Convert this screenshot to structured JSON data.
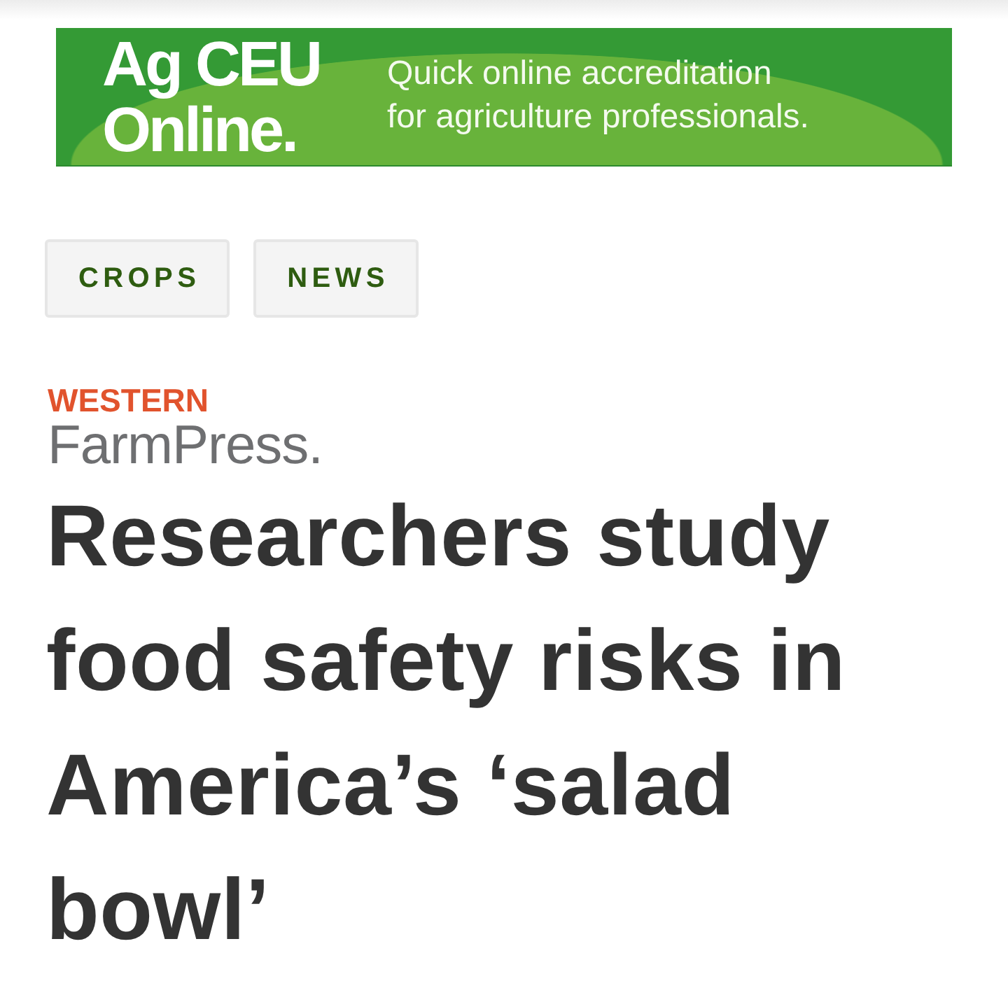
{
  "ad_banner": {
    "logo_lines": [
      "Ag CEU",
      "Online."
    ],
    "tagline_lines": [
      "Quick online accreditation",
      "for agriculture professionals."
    ]
  },
  "tags": [
    {
      "label": "CROPS"
    },
    {
      "label": "NEWS"
    }
  ],
  "publisher_logo": {
    "region": "WESTERN",
    "name": "FarmPress."
  },
  "headline": "Researchers study food safety risks in America’s ‘salad bowl’"
}
